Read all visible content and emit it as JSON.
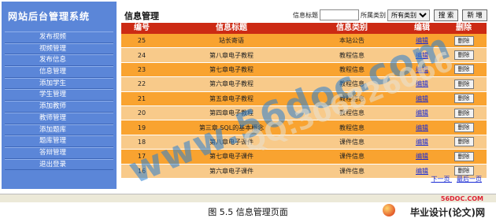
{
  "sidebar": {
    "title": "网站后台管理系统",
    "items": [
      "发布视频",
      "视频管理",
      "发布信息",
      "信息管理",
      "添加学生",
      "学生管理",
      "添加教师",
      "教师管理",
      "添加题库",
      "题库管理",
      "答辩管理",
      "退出登录"
    ]
  },
  "main": {
    "title": "信息管理",
    "search": {
      "title_label": "信息标题",
      "title_value": "",
      "category_label": "所属类别",
      "category_selected": "所有类别",
      "search_btn": "搜 索",
      "add_btn": "新 增"
    },
    "columns": [
      "编号",
      "信息标题",
      "信息类别",
      "编辑",
      "删除"
    ],
    "rows": [
      {
        "id": "25",
        "title": "站长寄语",
        "category": "本站公告",
        "edit": "编辑",
        "del": "删除"
      },
      {
        "id": "24",
        "title": "第八章电子教程",
        "category": "教程信息",
        "edit": "编辑",
        "del": "删除"
      },
      {
        "id": "23",
        "title": "第七章电子教程",
        "category": "教程信息",
        "edit": "编辑",
        "del": "删除"
      },
      {
        "id": "22",
        "title": "第六章电子教程",
        "category": "教程信息",
        "edit": "编辑",
        "del": "删除"
      },
      {
        "id": "21",
        "title": "第五章电子教程",
        "category": "教程信息",
        "edit": "编辑",
        "del": "删除"
      },
      {
        "id": "20",
        "title": "第四章电子教程",
        "category": "教程信息",
        "edit": "编辑",
        "del": "删除"
      },
      {
        "id": "19",
        "title": "第三章 SQL的基本概念",
        "category": "教程信息",
        "edit": "编辑",
        "del": "删除"
      },
      {
        "id": "18",
        "title": "第八章电子课件",
        "category": "课件信息",
        "edit": "编辑",
        "del": "删除"
      },
      {
        "id": "17",
        "title": "第七章电子课件",
        "category": "课件信息",
        "edit": "编辑",
        "del": "删除"
      },
      {
        "id": "16",
        "title": "第六章电子课件",
        "category": "课件信息",
        "edit": "编辑",
        "del": "删除"
      }
    ],
    "pager": {
      "next": "下一页",
      "last": "最后一页"
    }
  },
  "caption": "图 5.5  信息管理页面",
  "watermarks": {
    "site": "www.56doc.com",
    "qq": "QQ:306826066"
  },
  "logo": {
    "url": "56DOC.COM",
    "text": "毕业设计(论文)网"
  },
  "colors": {
    "sidebar": "#5b86d8",
    "header": "#cc2a14",
    "row_odd": "#f9a330",
    "row_even": "#f8ca8a"
  }
}
